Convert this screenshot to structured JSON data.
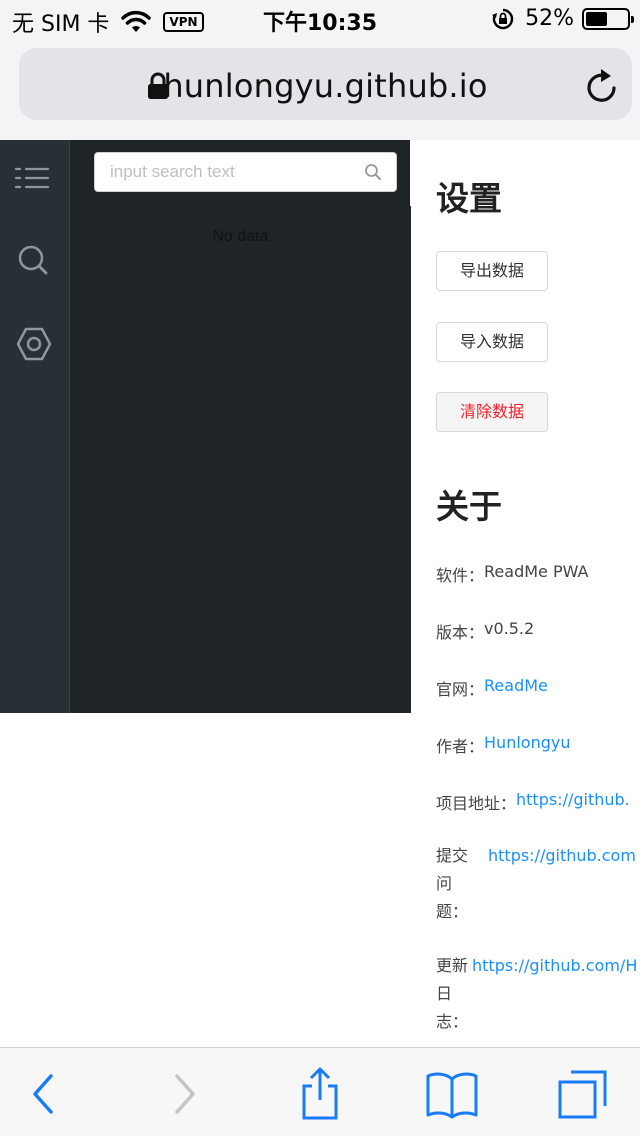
{
  "status_bar": {
    "carrier": "无 SIM 卡",
    "vpn_badge": "VPN",
    "time": "下午10:35",
    "battery_percent": "52%",
    "battery_level": 0.52
  },
  "browser": {
    "url": "hunlongyu.github.io"
  },
  "sidebar": {
    "icons": [
      "list-icon",
      "search-icon",
      "settings-hexagon-icon"
    ]
  },
  "drawer": {
    "search_placeholder": "input search text",
    "empty_text": "No data"
  },
  "settings": {
    "title": "设置",
    "export_label": "导出数据",
    "import_label": "导入数据",
    "clear_label": "清除数据"
  },
  "about": {
    "title": "关于",
    "software_label": "软件：",
    "software_value": "ReadMe PWA",
    "version_label": "版本：",
    "version_value": "v0.5.2",
    "site_label": "官网：",
    "site_link": "ReadMe",
    "author_label": "作者：",
    "author_link": "Hunlongyu",
    "project_label": "项目地址：",
    "project_link": "https://github.",
    "issue_label": "提交问题：",
    "issue_link": "https://github.com",
    "changelog_label": "更新日志：",
    "changelog_link": "https://github.com/H"
  },
  "colors": {
    "link": "#1890ff",
    "danger": "#f5222d",
    "rail_bg": "#263035",
    "drawer_bg": "#1f2426",
    "ios_blue": "#1a7cf5"
  }
}
